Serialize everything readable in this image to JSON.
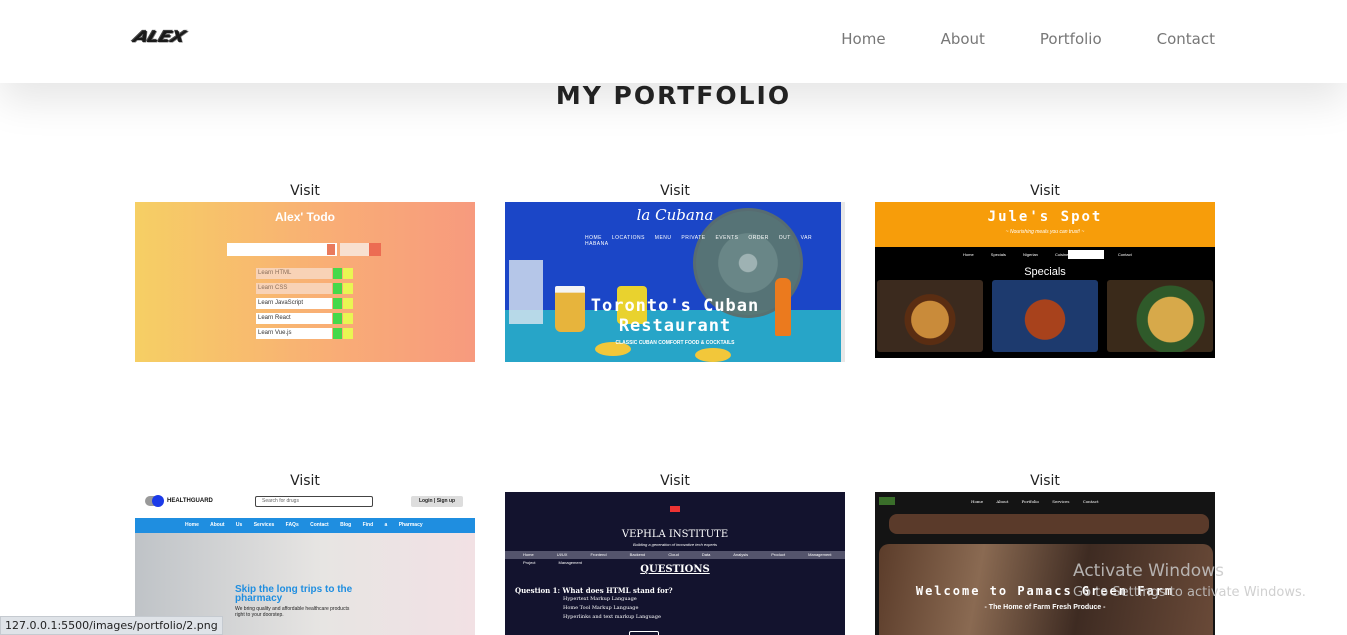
{
  "header": {
    "logo": "ALEX",
    "nav": [
      "Home",
      "About",
      "Portfolio",
      "Contact"
    ]
  },
  "section": {
    "title": "MY PORTFOLIO"
  },
  "cards": [
    {
      "visit": "Visit",
      "title": "Alex' Todo",
      "items": [
        "Learn HTML",
        "Learn CSS",
        "Learn JavaScript",
        "Learn React",
        "Learn Vue.js"
      ]
    },
    {
      "visit": "Visit",
      "brand": "la Cubana",
      "menu": "HOME LOCATIONS MENU PRIVATE EVENTS ORDER OUT VAR HABANA",
      "headline_1": "Toronto's Cuban",
      "headline_2": "Restaurant",
      "subline": "CLASSIC CUBAN COMFORT FOOD & COCKTAILS"
    },
    {
      "visit": "Visit",
      "title": "Jule's Spot",
      "tagline": "~ Nourishing meals you can trust! ~",
      "nav": "Home Specials Nigerian Cuisine Services Contact",
      "section": "Specials"
    },
    {
      "visit": "Visit",
      "brand": "HEALTHGUARD",
      "search_placeholder": "Search for drugs",
      "login": "Login | Sign up",
      "nav": "Home About Us Services FAQs Contact Blog Find a Pharmacy",
      "hero_title_1": "Skip the long trips to the",
      "hero_title_2": "pharmacy",
      "hero_sub_1": "We bring quality and affordable healthcare products",
      "hero_sub_2": "right to your doorstep."
    },
    {
      "visit": "Visit",
      "title": "VEPHLA INSTITUTE",
      "subtitle": "Building a generation of innovative tech experts",
      "nav": "Home UI/UX Frontend Backend Cloud Data Analysis Product Management Project Management",
      "heading": "QUESTIONS",
      "question": "Question 1: What does HTML stand for?",
      "options": [
        "Hypertext Markup Language",
        "Home Tool Markup Language",
        "Hyperlinks and text markup Language"
      ]
    },
    {
      "visit": "Visit",
      "nav": "Home About Portfolio Services Contact",
      "headline": "Welcome to Pamacs Green Farm",
      "subline": "- The Home of Farm Fresh Produce -"
    }
  ],
  "watermark": {
    "line1": "Activate Windows",
    "line2": "Go to Settings to activate Windows."
  },
  "status_url": "127.0.0.1:5500/images/portfolio/2.png"
}
